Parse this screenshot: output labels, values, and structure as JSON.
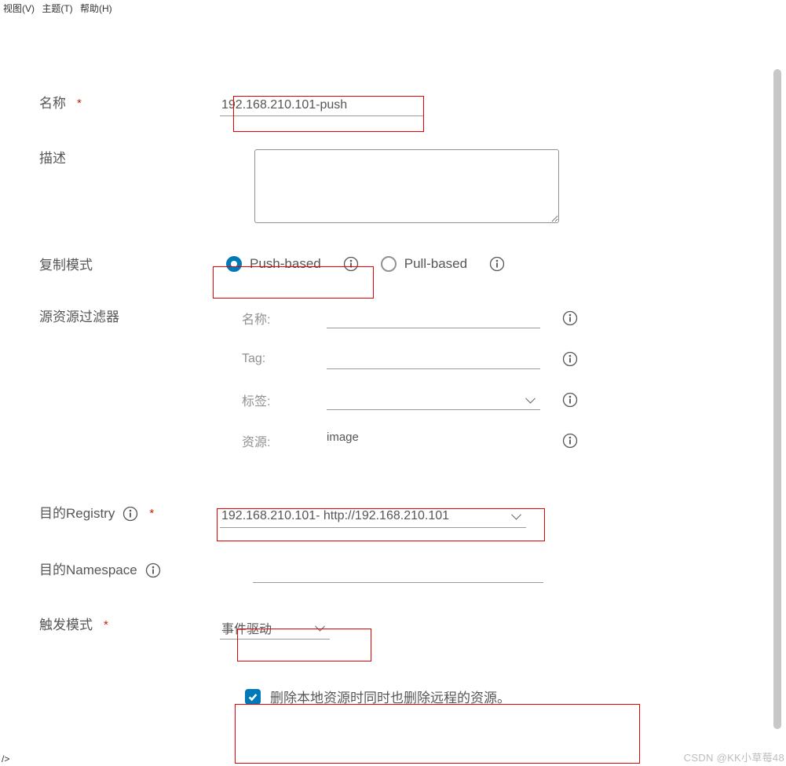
{
  "menubar": {
    "view": "视图(V)",
    "theme": "主题(T)",
    "help": "帮助(H)"
  },
  "form": {
    "name": {
      "label": "名称",
      "required": "*",
      "value": "192.168.210.101-push"
    },
    "description": {
      "label": "描述",
      "value": ""
    },
    "mode": {
      "label": "复制模式",
      "options": {
        "push": "Push-based",
        "pull": "Pull-based"
      },
      "selected": "push"
    },
    "filter": {
      "label": "源资源过滤器",
      "name_label": "名称:",
      "tag_label": "Tag:",
      "label_label": "标签:",
      "resource_label": "资源:",
      "resource_value": "image",
      "name_value": "",
      "tag_value": "",
      "label_value": ""
    },
    "dest_registry": {
      "label": "目的Registry",
      "required": "*",
      "value": "192.168.210.101- http://192.168.210.101"
    },
    "dest_ns": {
      "label": "目的Namespace",
      "value": ""
    },
    "trigger": {
      "label": "触发模式",
      "required": "*",
      "value": "事件驱动"
    },
    "delete_remote": {
      "label": "删除本地资源时同时也删除远程的资源。",
      "checked": true
    }
  },
  "watermark": "CSDN @KK小草莓48",
  "footer_tag": "/>"
}
